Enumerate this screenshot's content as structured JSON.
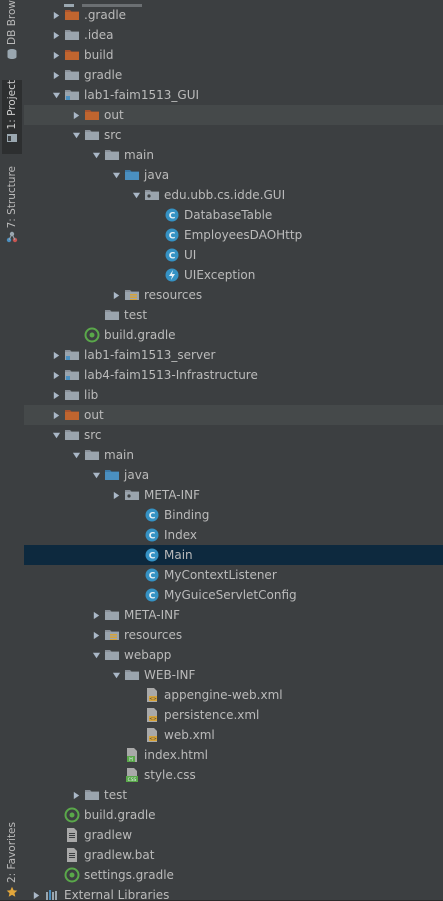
{
  "sidebar": {
    "tabs": [
      {
        "label": "DB Brow",
        "icon": "database-icon"
      },
      {
        "label": "1: Project",
        "icon": "project-icon",
        "active": true
      },
      {
        "label": "7: Structure",
        "icon": "structure-icon"
      },
      {
        "label": "2: Favorites",
        "icon": "star-icon"
      }
    ]
  },
  "tree": {
    "rows": [
      {
        "label": ".gradle",
        "depth": 1,
        "arrow": "right",
        "icon": "folder-excluded-icon"
      },
      {
        "label": ".idea",
        "depth": 1,
        "arrow": "right",
        "icon": "folder-icon"
      },
      {
        "label": "build",
        "depth": 1,
        "arrow": "right",
        "icon": "folder-excluded-icon"
      },
      {
        "label": "gradle",
        "depth": 1,
        "arrow": "right",
        "icon": "folder-icon"
      },
      {
        "label": "lab1-faim1513_GUI",
        "depth": 1,
        "arrow": "down",
        "icon": "module-folder-icon"
      },
      {
        "label": "out",
        "depth": 2,
        "arrow": "right",
        "icon": "folder-excluded-icon",
        "highlight": true
      },
      {
        "label": "src",
        "depth": 2,
        "arrow": "down",
        "icon": "folder-icon"
      },
      {
        "label": "main",
        "depth": 3,
        "arrow": "down",
        "icon": "folder-icon"
      },
      {
        "label": "java",
        "depth": 4,
        "arrow": "down",
        "icon": "source-folder-icon"
      },
      {
        "label": "edu.ubb.cs.idde.GUI",
        "depth": 5,
        "arrow": "down",
        "icon": "package-icon"
      },
      {
        "label": "DatabaseTable",
        "depth": 6,
        "arrow": "none",
        "icon": "class-icon"
      },
      {
        "label": "EmployeesDAOHttp",
        "depth": 6,
        "arrow": "none",
        "icon": "class-icon"
      },
      {
        "label": "UI",
        "depth": 6,
        "arrow": "none",
        "icon": "class-icon"
      },
      {
        "label": "UIException",
        "depth": 6,
        "arrow": "none",
        "icon": "exception-class-icon"
      },
      {
        "label": "resources",
        "depth": 4,
        "arrow": "right",
        "icon": "resources-folder-icon"
      },
      {
        "label": "test",
        "depth": 3,
        "arrow": "none",
        "icon": "folder-icon"
      },
      {
        "label": "build.gradle",
        "depth": 2,
        "arrow": "none",
        "icon": "gradle-icon"
      },
      {
        "label": "lab1-faim1513_server",
        "depth": 1,
        "arrow": "right",
        "icon": "module-folder-icon"
      },
      {
        "label": "lab4-faim1513-Infrastructure",
        "depth": 1,
        "arrow": "right",
        "icon": "module-folder-icon"
      },
      {
        "label": "lib",
        "depth": 1,
        "arrow": "right",
        "icon": "folder-icon"
      },
      {
        "label": "out",
        "depth": 1,
        "arrow": "right",
        "icon": "folder-excluded-icon",
        "highlight": true
      },
      {
        "label": "src",
        "depth": 1,
        "arrow": "down",
        "icon": "folder-icon"
      },
      {
        "label": "main",
        "depth": 2,
        "arrow": "down",
        "icon": "folder-icon"
      },
      {
        "label": "java",
        "depth": 3,
        "arrow": "down",
        "icon": "source-folder-icon"
      },
      {
        "label": "META-INF",
        "depth": 4,
        "arrow": "right",
        "icon": "package-icon"
      },
      {
        "label": "Binding",
        "depth": 5,
        "arrow": "none",
        "icon": "class-icon"
      },
      {
        "label": "Index",
        "depth": 5,
        "arrow": "none",
        "icon": "class-icon"
      },
      {
        "label": "Main",
        "depth": 5,
        "arrow": "none",
        "icon": "class-icon",
        "selected": true
      },
      {
        "label": "MyContextListener",
        "depth": 5,
        "arrow": "none",
        "icon": "class-icon"
      },
      {
        "label": "MyGuiceServletConfig",
        "depth": 5,
        "arrow": "none",
        "icon": "class-icon"
      },
      {
        "label": "META-INF",
        "depth": 3,
        "arrow": "right",
        "icon": "folder-icon"
      },
      {
        "label": "resources",
        "depth": 3,
        "arrow": "right",
        "icon": "resources-folder-icon"
      },
      {
        "label": "webapp",
        "depth": 3,
        "arrow": "down",
        "icon": "folder-icon"
      },
      {
        "label": "WEB-INF",
        "depth": 4,
        "arrow": "down",
        "icon": "folder-icon"
      },
      {
        "label": "appengine-web.xml",
        "depth": 5,
        "arrow": "none",
        "icon": "xml-file-icon"
      },
      {
        "label": "persistence.xml",
        "depth": 5,
        "arrow": "none",
        "icon": "xml-file-icon"
      },
      {
        "label": "web.xml",
        "depth": 5,
        "arrow": "none",
        "icon": "xml-file-icon"
      },
      {
        "label": "index.html",
        "depth": 4,
        "arrow": "none",
        "icon": "html-file-icon"
      },
      {
        "label": "style.css",
        "depth": 4,
        "arrow": "none",
        "icon": "css-file-icon"
      },
      {
        "label": "test",
        "depth": 2,
        "arrow": "right",
        "icon": "folder-icon"
      },
      {
        "label": "build.gradle",
        "depth": 1,
        "arrow": "none",
        "icon": "gradle-icon"
      },
      {
        "label": "gradlew",
        "depth": 1,
        "arrow": "none",
        "icon": "text-file-icon"
      },
      {
        "label": "gradlew.bat",
        "depth": 1,
        "arrow": "none",
        "icon": "text-file-icon"
      },
      {
        "label": "settings.gradle",
        "depth": 1,
        "arrow": "none",
        "icon": "gradle-icon"
      },
      {
        "label": "External Libraries",
        "depth": 0,
        "arrow": "right",
        "icon": "libraries-icon"
      }
    ]
  },
  "colors": {
    "panel_bg": "#3c3f41",
    "selection": "#0d293e",
    "excluded_folder": "#c75450",
    "folder": "#8a9199",
    "source_folder": "#4a8fc0",
    "class_icon": "#3592c4",
    "text": "#bbbbbb"
  }
}
